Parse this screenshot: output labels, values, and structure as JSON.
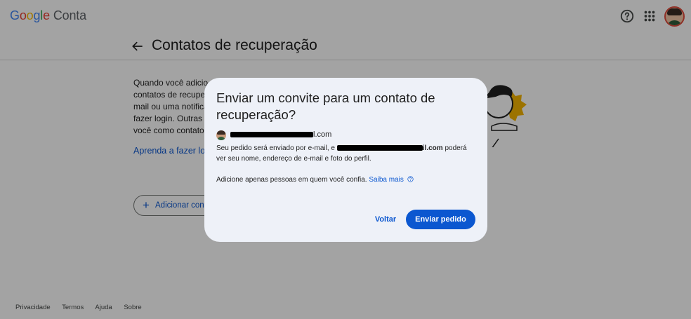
{
  "header": {
    "logo": {
      "google": [
        "G",
        "o",
        "o",
        "g",
        "l",
        "e"
      ],
      "product": "Conta"
    },
    "icons": [
      "help-icon",
      "apps-icon"
    ],
    "avatar": "user-avatar"
  },
  "page": {
    "title": "Contatos de recuperação",
    "back_icon": "arrow-left-icon"
  },
  "background": {
    "paragraph_lines": [
      "Quando você adicio",
      "contatos de recupe",
      "mail ou uma notifica",
      "fazer login. Outras p",
      "você como contato"
    ],
    "link": "Aprenda a fazer logi",
    "add_button": "Adicionar cont"
  },
  "footer": {
    "links": [
      "Privacidade",
      "Termos",
      "Ajuda",
      "Sobre"
    ]
  },
  "dialog": {
    "title": "Enviar um convite para um contato de recuperação?",
    "email_suffix": "l.com",
    "body_start": "Seu pedido será enviado por e-mail, e",
    "body_email_suffix": "il.com",
    "body_end": "poderá ver seu nome, endereço de e-mail e foto do perfil.",
    "note": "Adicione apenas pessoas em quem você confia.",
    "learn_more": "Saiba mais",
    "back_button": "Voltar",
    "send_button": "Enviar pedido"
  },
  "colors": {
    "primary": "#0b57d0",
    "dialog_bg": "#eef1f8",
    "scrim": "rgba(0,0,0,0.36)"
  }
}
